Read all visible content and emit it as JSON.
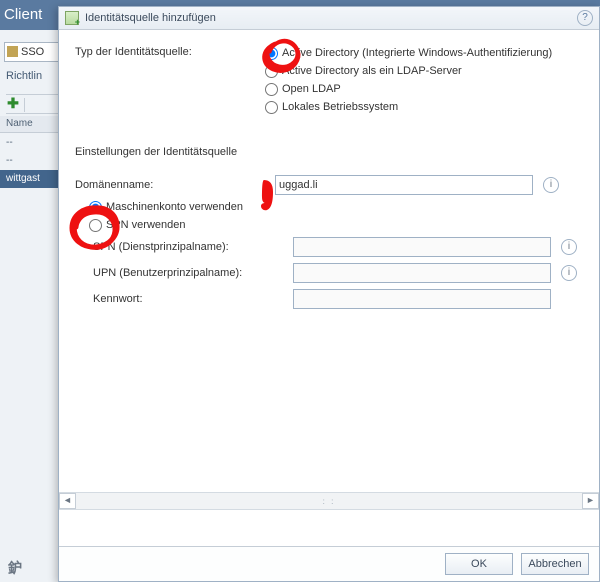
{
  "app": {
    "title": "Client"
  },
  "bg": {
    "sso_label": "SSO",
    "tab": "Richtlin",
    "name_col": "Name",
    "rows": [
      "--",
      "--",
      "wittgast"
    ]
  },
  "modal": {
    "title": "Identitätsquelle hinzufügen",
    "type_label": "Typ der Identitätsquelle:",
    "type_options": {
      "ad_integrated": "Active Directory (Integrierte Windows-Authentifizierung)",
      "ad_ldap": "Active Directory als ein LDAP-Server",
      "openldap": "Open LDAP",
      "local_os": "Lokales Betriebssystem"
    },
    "settings_header": "Einstellungen der Identitätsquelle",
    "fields": {
      "domain_label": "Domänenname:",
      "domain_value": "uggad.li",
      "use_machine": "Maschinenkonto verwenden",
      "use_spn": "SPN verwenden",
      "spn_label": "SPN (Dienstprinzipalname):",
      "upn_label": "UPN (Benutzerprinzipalname):",
      "pw_label": "Kennwort:"
    },
    "buttons": {
      "ok": "OK",
      "cancel": "Abbrechen"
    }
  }
}
